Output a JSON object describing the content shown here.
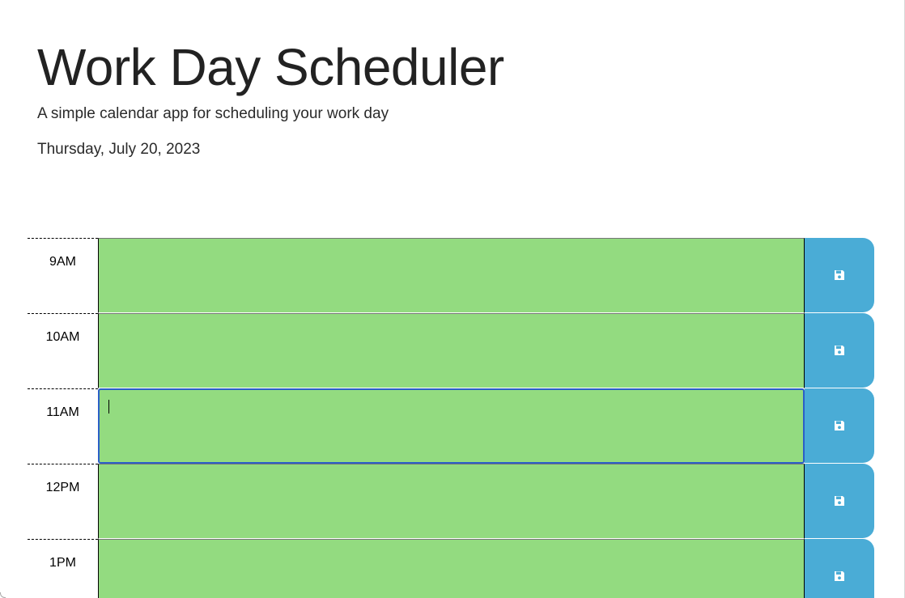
{
  "header": {
    "title": "Work Day Scheduler",
    "lead": "A simple calendar app for scheduling your work day",
    "current_day": "Thursday, July 20, 2023"
  },
  "colors": {
    "present_or_future": "#93db80",
    "save_button": "#4aacd6",
    "focus_border": "#2b5fc7"
  },
  "icons": {
    "save": "floppy-disk-icon"
  },
  "schedule": {
    "rows": [
      {
        "hour": "9AM",
        "text": ""
      },
      {
        "hour": "10AM",
        "text": ""
      },
      {
        "hour": "11AM",
        "text": ""
      },
      {
        "hour": "12PM",
        "text": ""
      },
      {
        "hour": "1PM",
        "text": ""
      }
    ]
  }
}
